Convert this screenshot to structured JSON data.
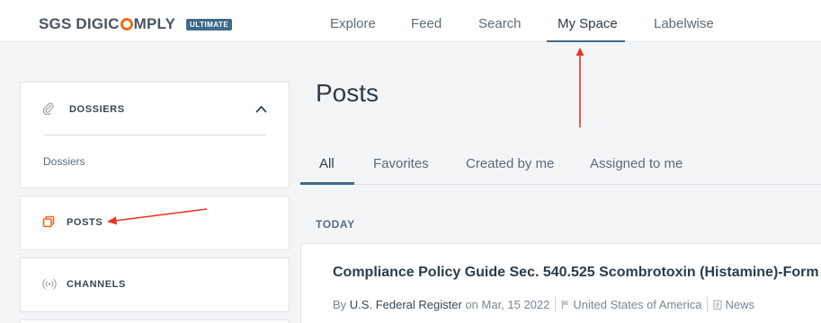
{
  "header": {
    "logo_left": "SGS DIGIC",
    "logo_right": "MPLY",
    "badge": "ULTIMATE",
    "nav": [
      {
        "label": "Explore",
        "active": false
      },
      {
        "label": "Feed",
        "active": false
      },
      {
        "label": "Search",
        "active": false
      },
      {
        "label": "My Space",
        "active": true
      },
      {
        "label": "Labelwise",
        "active": false
      }
    ]
  },
  "sidebar": {
    "dossiers": {
      "title": "DOSSIERS",
      "icon": "paperclip-icon",
      "expanded": true,
      "sub_item": "Dossiers"
    },
    "posts": {
      "title": "POSTS",
      "icon": "posts-icon"
    },
    "channels": {
      "title": "CHANNELS",
      "icon": "broadcast-icon"
    }
  },
  "main": {
    "title": "Posts",
    "tabs": [
      {
        "label": "All",
        "active": true
      },
      {
        "label": "Favorites",
        "active": false
      },
      {
        "label": "Created by me",
        "active": false
      },
      {
        "label": "Assigned to me",
        "active": false
      }
    ],
    "section_label": "TODAY",
    "post": {
      "title": "Compliance Policy Guide Sec. 540.525 Scombrotoxin (Histamine)-Form",
      "by_label": "By",
      "source": "U.S. Federal Register",
      "on_label": "on",
      "date": "Mar, 15 2022",
      "country": "United States of America",
      "type": "News"
    }
  },
  "colors": {
    "accent": "#3f6b8a",
    "brand_orange": "#ef6c1a",
    "annotation_red": "#e8341f"
  }
}
